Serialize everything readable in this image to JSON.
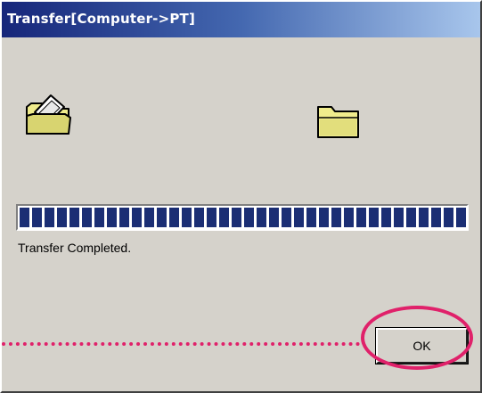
{
  "window": {
    "title": "Transfer[Computer->PT]"
  },
  "progress": {
    "value": 1.0,
    "status": "Transfer Completed."
  },
  "buttons": {
    "ok": "OK"
  },
  "icons": {
    "source": "folder-open-icon",
    "destination": "folder-icon"
  },
  "colors": {
    "titlebar_start": "#16267a",
    "titlebar_end": "#a8c6ec",
    "dialog_bg": "#d5d2cb",
    "progress_fill": "#1b2e74",
    "annotation": "#e0216a",
    "folder": "#f0ec8c"
  }
}
